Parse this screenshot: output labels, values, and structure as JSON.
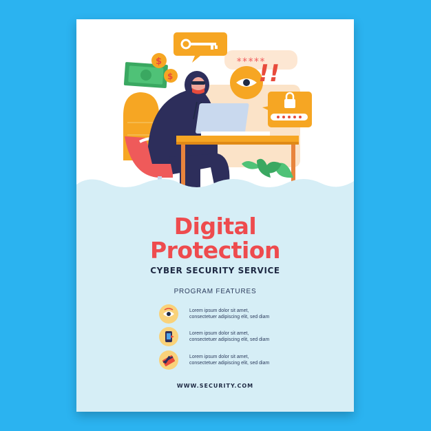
{
  "poster": {
    "title_line1": "Digital",
    "title_line2": "Protection",
    "subtitle": "CYBER SECURITY SERVICE",
    "features_heading": "PROGRAM FEATURES",
    "features": [
      {
        "icon": "eye-icon",
        "line1": "Lorem ipsum dolor sit amet,",
        "line2": "consectetuer adipiscing elit, sed diam"
      },
      {
        "icon": "phone-security-icon",
        "line1": "Lorem ipsum dolor sit amet,",
        "line2": "consectetuer adipiscing elit, sed diam"
      },
      {
        "icon": "credit-card-icon",
        "line1": "Lorem ipsum dolor sit amet,",
        "line2": "consectetuer adipiscing elit, sed diam"
      }
    ],
    "website": "WWW.SECURITY.COM"
  },
  "illustration": {
    "password_mask": "*****",
    "alert_marks": "!!"
  },
  "colors": {
    "background": "#2bb3f0",
    "poster_bottom": "#d6eef6",
    "title": "#ee4b4e",
    "accent_orange": "#f6a623",
    "dark_text": "#1f2a44"
  }
}
